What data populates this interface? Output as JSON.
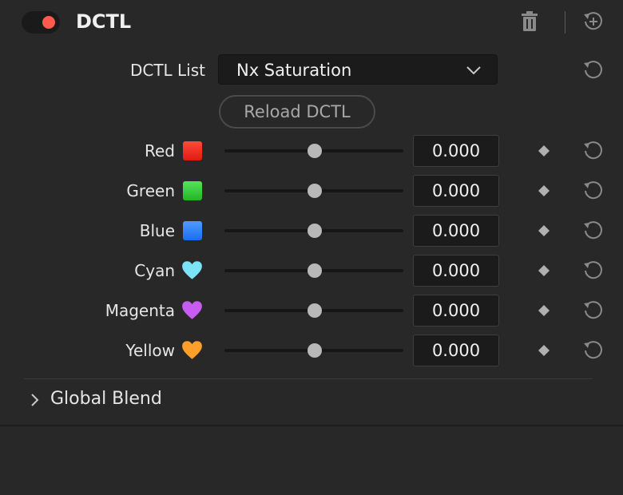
{
  "header": {
    "title": "DCTL",
    "toggle_state": "on",
    "toggle_color": "#ff5a4e",
    "icons": [
      "delete-icon",
      "reset-add-icon"
    ]
  },
  "dctl_list": {
    "label": "DCTL List",
    "selected": "Nx Saturation",
    "reload_label": "Reload DCTL"
  },
  "sliders": [
    {
      "label": "Red",
      "swatch": "red-square",
      "color": "#ff2b1f",
      "value": "0.000"
    },
    {
      "label": "Green",
      "swatch": "green-square",
      "color": "#36d33a",
      "value": "0.000"
    },
    {
      "label": "Blue",
      "swatch": "blue-square",
      "color": "#2f86ff",
      "value": "0.000"
    },
    {
      "label": "Cyan",
      "swatch": "cyan-heart",
      "color": "#7be3f5",
      "value": "0.000"
    },
    {
      "label": "Magenta",
      "swatch": "purple-heart",
      "color": "#c85cf0",
      "value": "0.000"
    },
    {
      "label": "Yellow",
      "swatch": "orange-heart",
      "color": "#ff9f2b",
      "value": "0.000"
    }
  ],
  "global_blend": {
    "label": "Global Blend",
    "expanded": false
  }
}
